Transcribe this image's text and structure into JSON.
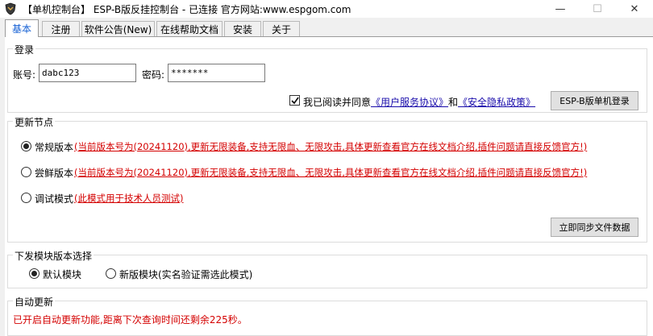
{
  "window": {
    "title": "【单机控制台】 ESP-B版反挂控制台 - 已连接   官方网站:www.espgom.com",
    "minimize_glyph": "—",
    "maximize_glyph": "☐",
    "close_glyph": "✕"
  },
  "tabs": [
    {
      "label": "基本",
      "active": true
    },
    {
      "label": "注册"
    },
    {
      "label": "软件公告(New)"
    },
    {
      "label": "在线帮助文档"
    },
    {
      "label": "安装"
    },
    {
      "label": "关于"
    }
  ],
  "login": {
    "legend": "登录",
    "account_label": "账号:",
    "account_value": "dabc123",
    "password_label": "密码:",
    "password_value": "*******",
    "agree_checked": true,
    "agree_text": "我已阅读并同意",
    "terms_link": "《用户服务协议》",
    "and_text": "和",
    "privacy_link": "《安全隐私政策》",
    "login_button": "ESP-B版单机登录"
  },
  "update_nodes": {
    "legend": "更新节点",
    "options": [
      {
        "label": "常规版本",
        "checked": true,
        "note": "(当前版本号为(20241120),更新无限装备,支持无限血、无限攻击,具体更新查看官方在线文档介绍,插件问题请直接反馈官方!)"
      },
      {
        "label": "尝鲜版本",
        "checked": false,
        "note": "(当前版本号为(20241120),更新无限装备,支持无限血、无限攻击,具体更新查看官方在线文档介绍,插件问题请直接反馈官方!)"
      },
      {
        "label": "调试模式",
        "checked": false,
        "note": "(此模式用于技术人员测试)"
      }
    ],
    "sync_button": "立即同步文件数据"
  },
  "module_select": {
    "legend": "下发模块版本选择",
    "options": [
      {
        "label": "默认模块",
        "checked": true
      },
      {
        "label": "新版模块(实名验证需选此模式)",
        "checked": false
      }
    ]
  },
  "auto_update": {
    "legend": "自动更新",
    "status": "已开启自动更新功能,距离下次查询时间还剩余225秒。"
  },
  "colors": {
    "accent": "#1560d4",
    "warning_red": "#d40000",
    "link_blue": "#1a0dab"
  }
}
